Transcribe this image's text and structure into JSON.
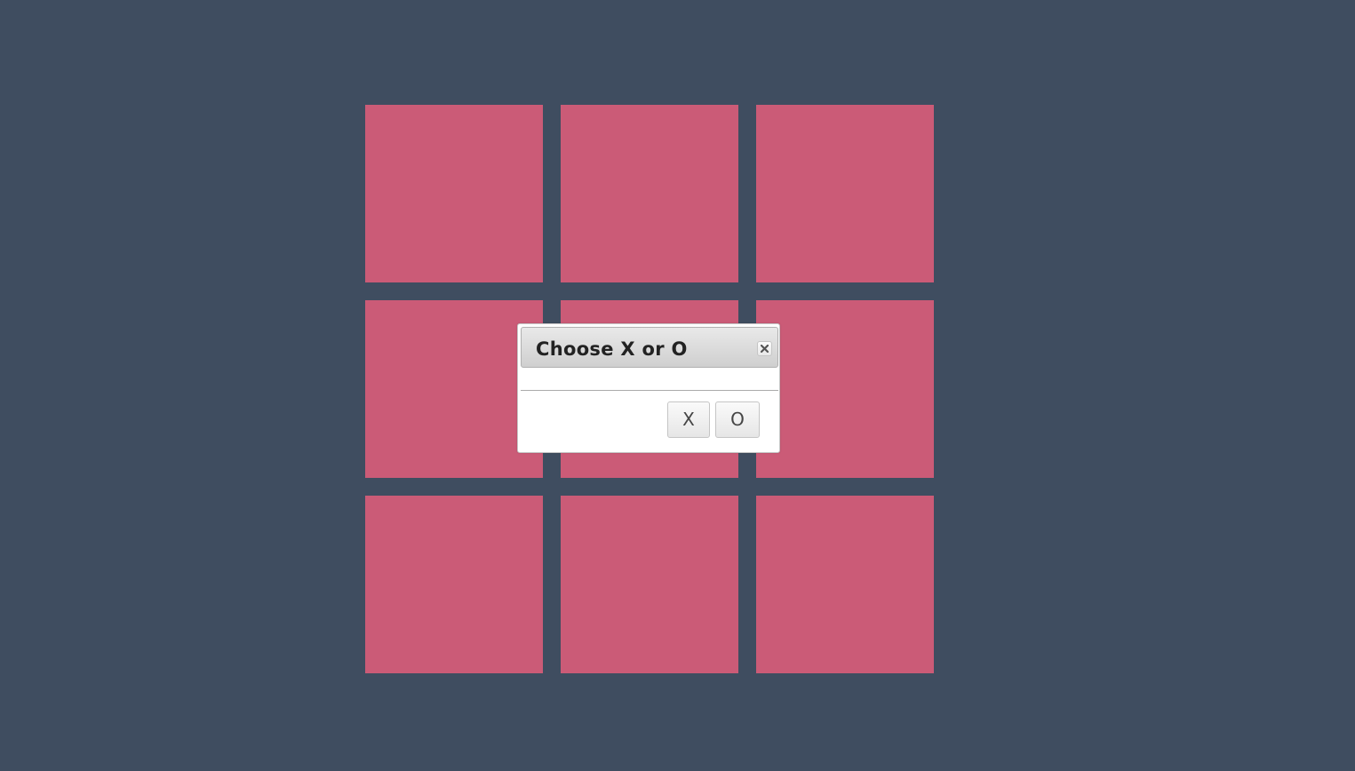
{
  "colors": {
    "background": "#3f4d60",
    "cell": "#cb5b77"
  },
  "board": {
    "rows": 3,
    "cols": 3,
    "cells": [
      "",
      "",
      "",
      "",
      "",
      "",
      "",
      "",
      ""
    ]
  },
  "dialog": {
    "title": "Choose X or O",
    "close_icon": "close-icon",
    "content": "",
    "buttons": [
      {
        "label": "X"
      },
      {
        "label": "O"
      }
    ]
  }
}
